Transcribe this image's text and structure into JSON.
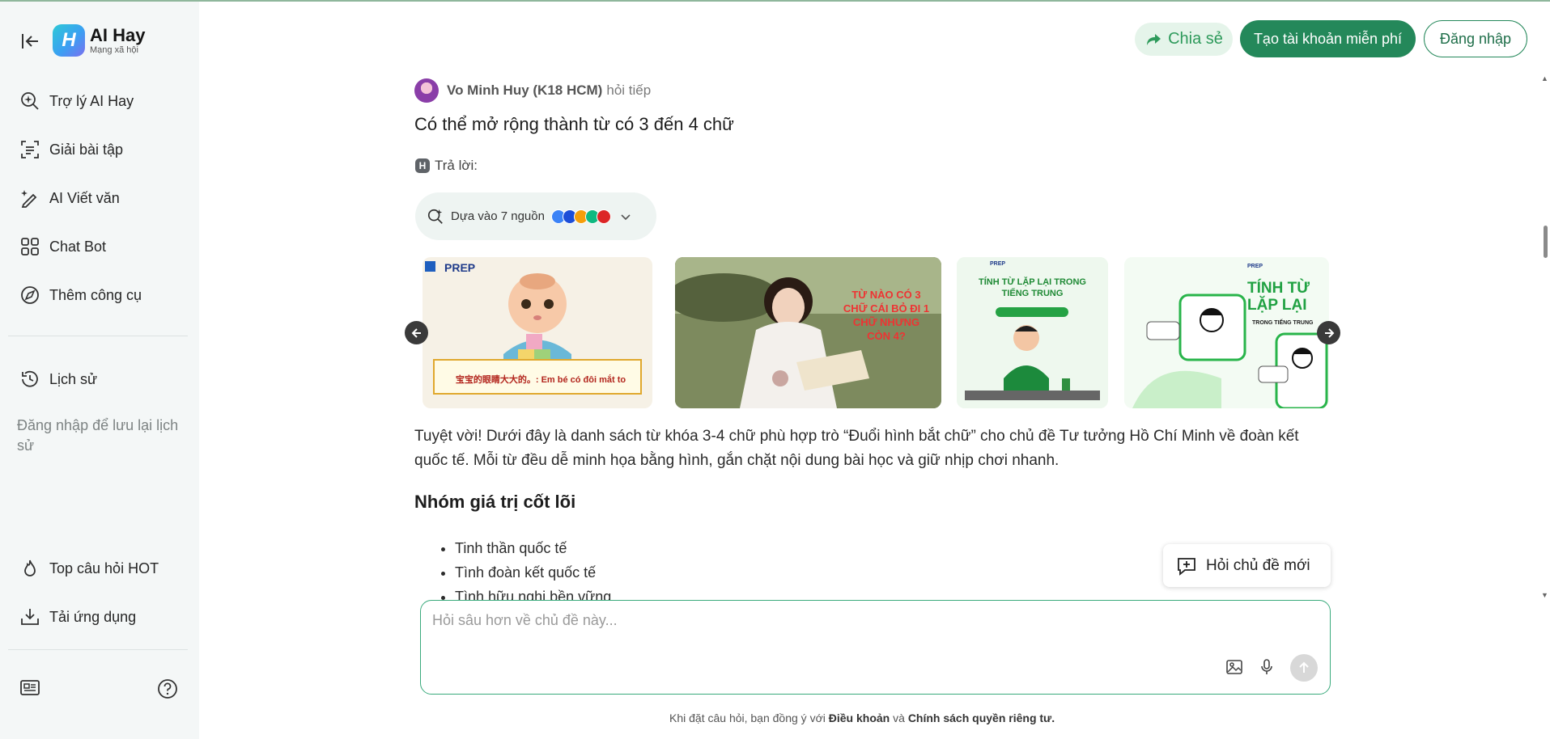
{
  "app": {
    "logo_title": "AI Hay",
    "logo_subtitle": "Mạng xã hội"
  },
  "sidebar": {
    "items": [
      {
        "label": "Trợ lý AI Hay",
        "icon": "search-sparkle-icon"
      },
      {
        "label": "Giải bài tập",
        "icon": "scan-icon"
      },
      {
        "label": "AI Viết văn",
        "icon": "pen-sparkle-icon"
      },
      {
        "label": "Chat Bot",
        "icon": "grid-icon"
      },
      {
        "label": "Thêm công cụ",
        "icon": "compass-icon"
      }
    ],
    "history_label": "Lịch sử",
    "history_hint": "Đăng nhập để lưu lại lịch sử",
    "bottom_items": [
      {
        "label": "Top câu hỏi HOT",
        "icon": "fire-icon"
      },
      {
        "label": "Tải ứng dụng",
        "icon": "download-icon"
      }
    ]
  },
  "header": {
    "share_label": "Chia sẻ",
    "signup_label": "Tạo tài khoản miễn phí",
    "login_label": "Đăng nhập"
  },
  "thread": {
    "asker_name": "Vo Minh Huy (K18 HCM)",
    "asker_action": "hỏi tiếp",
    "question": "Có thể mở rộng thành từ có 3 đến 4 chữ",
    "answer_label": "Trả lời:",
    "sources_label": "Dựa vào 7 nguồn"
  },
  "images": [
    {
      "brand": "PREP",
      "caption": "宝宝的眼睛大大的。: Em bé có đôi mắt to"
    },
    {
      "caption": "TỪ NÀO CÓ 3 CHỮ CÁI BỎ ĐI 1 CHỮ NHƯNG CÒN 4?"
    },
    {
      "brand": "PREP",
      "caption": "TÍNH TỪ LẶP LẠI TRONG TIẾNG TRUNG"
    },
    {
      "brand": "PREP",
      "caption": "TÍNH TỪ LẶP LẠI",
      "sub": "TRONG TIẾNG TRUNG"
    }
  ],
  "answer": {
    "intro": "Tuyệt vời! Dưới đây là danh sách từ khóa 3-4 chữ phù hợp trò “Đuổi hình bắt chữ” cho chủ đề Tư tưởng Hồ Chí Minh về đoàn kết quốc tế. Mỗi từ đều dễ minh họa bằng hình, gắn chặt nội dung bài học và giữ nhịp chơi nhanh.",
    "section_title": "Nhóm giá trị cốt lõi",
    "bullets": [
      "Tinh thần quốc tế",
      "Tình đoàn kết quốc tế",
      "Tình hữu nghị bền vững"
    ]
  },
  "new_topic_label": "Hỏi chủ đề mới",
  "composer": {
    "placeholder": "Hỏi sâu hơn về chủ đề này..."
  },
  "footer": {
    "prefix": "Khi đặt câu hỏi, bạn đồng ý với",
    "terms": "Điều khoản",
    "and": "và",
    "privacy": "Chính sách quyền riêng tư."
  },
  "colors": {
    "brand_green": "#24885a",
    "sidebar_bg": "#f4f7f7",
    "share_bg": "#e5f4ea"
  }
}
